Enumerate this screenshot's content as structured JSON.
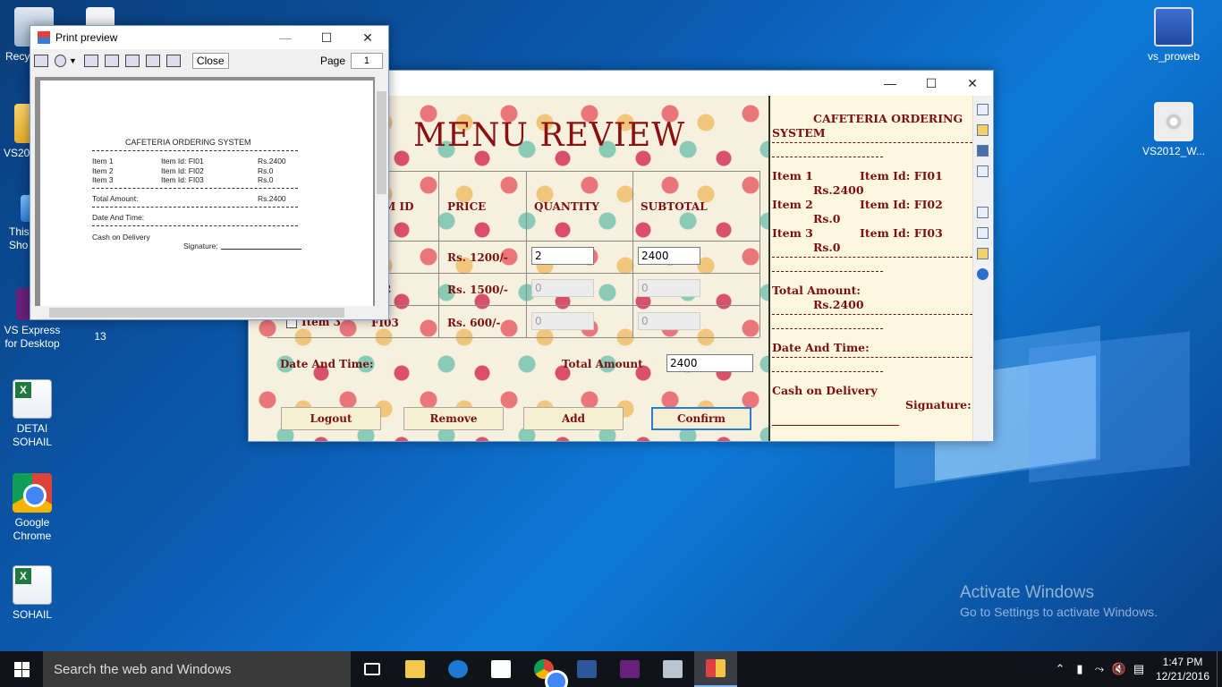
{
  "desktop": {
    "icons": [
      {
        "label": "Recy"
      },
      {
        "label": "VS201"
      },
      {
        "label": "This\nSho"
      },
      {
        "label": "VS Express\nfor Desktop"
      },
      {
        "label": "13"
      },
      {
        "label": "DETAI\nSOHAIL"
      },
      {
        "label": "Google\nChrome"
      },
      {
        "label": "SOHAIL"
      },
      {
        "label": "vs_proweb"
      },
      {
        "label": "VS2012_W..."
      }
    ],
    "watermark": {
      "line1": "Activate Windows",
      "line2": "Go to Settings to activate Windows."
    }
  },
  "print_preview": {
    "title": "Print preview",
    "close_label": "Close",
    "page_label": "Page",
    "page_value": "1",
    "page": {
      "heading": "CAFETERIA ORDERING SYSTEM",
      "rows": [
        {
          "item": "Item 1",
          "id": "Item Id: FI01",
          "price": "Rs.2400"
        },
        {
          "item": "Item 2",
          "id": "Item Id: FI02",
          "price": "Rs.0"
        },
        {
          "item": "Item 3",
          "id": "Item Id: FI03",
          "price": "Rs.0"
        }
      ],
      "total_label": "Total Amount:",
      "total_value": "Rs.2400",
      "date_label": "Date And Time:",
      "payment": "Cash on Delivery",
      "signature": "Signature:"
    }
  },
  "app": {
    "heading": "MENU REVIEW",
    "columns": [
      "M ID",
      "PRICE",
      "QUANTITY",
      "SUBTOTAL"
    ],
    "rows": [
      {
        "id": "I",
        "price": "Rs. 1200/-",
        "quantity": "2",
        "subtotal": "2400"
      },
      {
        "id": "2",
        "price": "Rs. 1500/-",
        "quantity": "0",
        "subtotal": "0"
      },
      {
        "item": "Item 3",
        "id": "FI03",
        "price": "Rs. 600/-",
        "quantity": "0",
        "subtotal": "0"
      }
    ],
    "date_label": "Date And Time:",
    "total_label": "Total Amount",
    "total_value": "2400",
    "buttons": {
      "logout": "Logout",
      "remove": "Remove",
      "add": "Add",
      "confirm": "Confirm"
    },
    "receipt": {
      "heading1": "CAFETERIA ORDERING",
      "heading2": "SYSTEM",
      "items": [
        {
          "item": "Item 1",
          "id": "Item Id: FI01",
          "price": "Rs.2400"
        },
        {
          "item": "Item 2",
          "id": "Item Id: FI02",
          "price": "Rs.0"
        },
        {
          "item": "Item 3",
          "id": "Item Id: FI03",
          "price": "Rs.0"
        }
      ],
      "total_label": "Total Amount:",
      "total_value": "Rs.2400",
      "date_label": "Date And Time:",
      "payment": "Cash on Delivery",
      "signature": "Signature:"
    }
  },
  "taskbar": {
    "search_placeholder": "Search the web and Windows",
    "time": "1:47 PM",
    "date": "12/21/2016"
  }
}
